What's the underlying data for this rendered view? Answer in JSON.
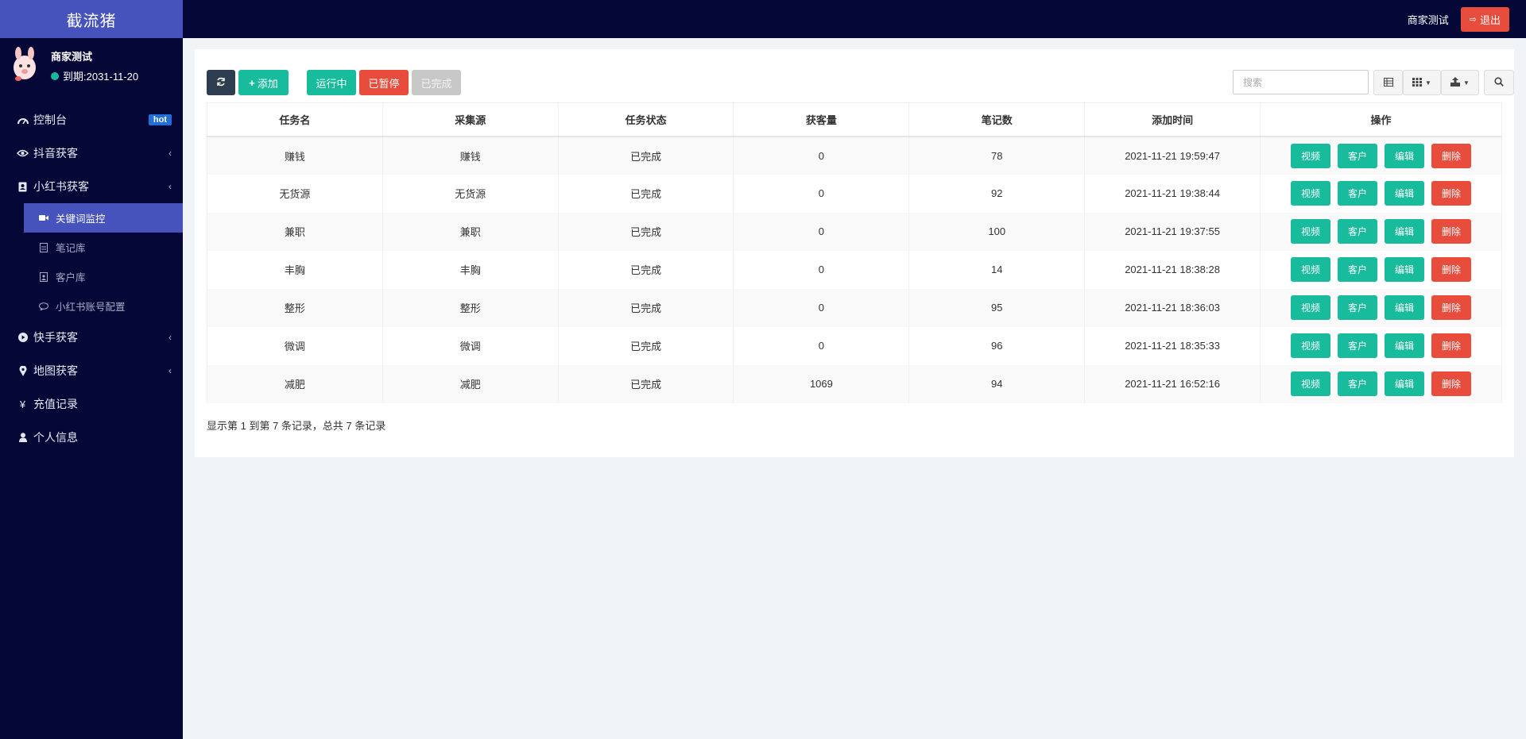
{
  "sidebar": {
    "logo": "截流猪",
    "user": {
      "name": "商家测试",
      "expire": "到期:2031-11-20",
      "status_color": "#18bc9c"
    },
    "items": [
      {
        "label": "控制台",
        "icon": "dashboard-icon",
        "badge": "hot"
      },
      {
        "label": "抖音获客",
        "icon": "eye-icon"
      },
      {
        "label": "小红书获客",
        "icon": "contact-book-icon"
      },
      {
        "label": "快手获客",
        "icon": "play-circle-icon"
      },
      {
        "label": "地图获客",
        "icon": "map-marker-icon"
      },
      {
        "label": "充值记录",
        "icon": "yen-icon"
      },
      {
        "label": "个人信息",
        "icon": "user-icon"
      }
    ],
    "subitems": [
      {
        "label": "关键词监控",
        "icon": "video-camera-icon",
        "active": true
      },
      {
        "label": "笔记库",
        "icon": "file-icon"
      },
      {
        "label": "客户库",
        "icon": "contact-icon"
      },
      {
        "label": "小红书账号配置",
        "icon": "comment-icon"
      }
    ]
  },
  "topbar": {
    "user": "商家测试",
    "logout": "退出"
  },
  "toolbar": {
    "add": "添加",
    "running": "运行中",
    "paused": "已暂停",
    "done": "已完成",
    "search_placeholder": "搜索"
  },
  "table": {
    "headers": [
      "任务名",
      "采集源",
      "任务状态",
      "获客量",
      "笔记数",
      "添加时间",
      "操作"
    ],
    "actions": [
      "视频",
      "客户",
      "编辑",
      "删除"
    ],
    "rows": [
      {
        "name": "赚钱",
        "source": "赚钱",
        "status": "已完成",
        "customers": "0",
        "notes": "78",
        "time": "2021-11-21 19:59:47"
      },
      {
        "name": "无货源",
        "source": "无货源",
        "status": "已完成",
        "customers": "0",
        "notes": "92",
        "time": "2021-11-21 19:38:44"
      },
      {
        "name": "兼职",
        "source": "兼职",
        "status": "已完成",
        "customers": "0",
        "notes": "100",
        "time": "2021-11-21 19:37:55"
      },
      {
        "name": "丰胸",
        "source": "丰胸",
        "status": "已完成",
        "customers": "0",
        "notes": "14",
        "time": "2021-11-21 18:38:28"
      },
      {
        "name": "整形",
        "source": "整形",
        "status": "已完成",
        "customers": "0",
        "notes": "95",
        "time": "2021-11-21 18:36:03"
      },
      {
        "name": "微调",
        "source": "微调",
        "status": "已完成",
        "customers": "0",
        "notes": "96",
        "time": "2021-11-21 18:35:33"
      },
      {
        "name": "减肥",
        "source": "减肥",
        "status": "已完成",
        "customers": "1069",
        "notes": "94",
        "time": "2021-11-21 16:52:16"
      }
    ]
  },
  "pager": {
    "summary": "显示第 1 到第 7 条记录，总共 7 条记录"
  },
  "colors": {
    "accent": "#4753bd",
    "sidebar_bg": "#050836",
    "green": "#18bc9c",
    "red": "#e74c3c",
    "dark": "#2c3e50"
  }
}
